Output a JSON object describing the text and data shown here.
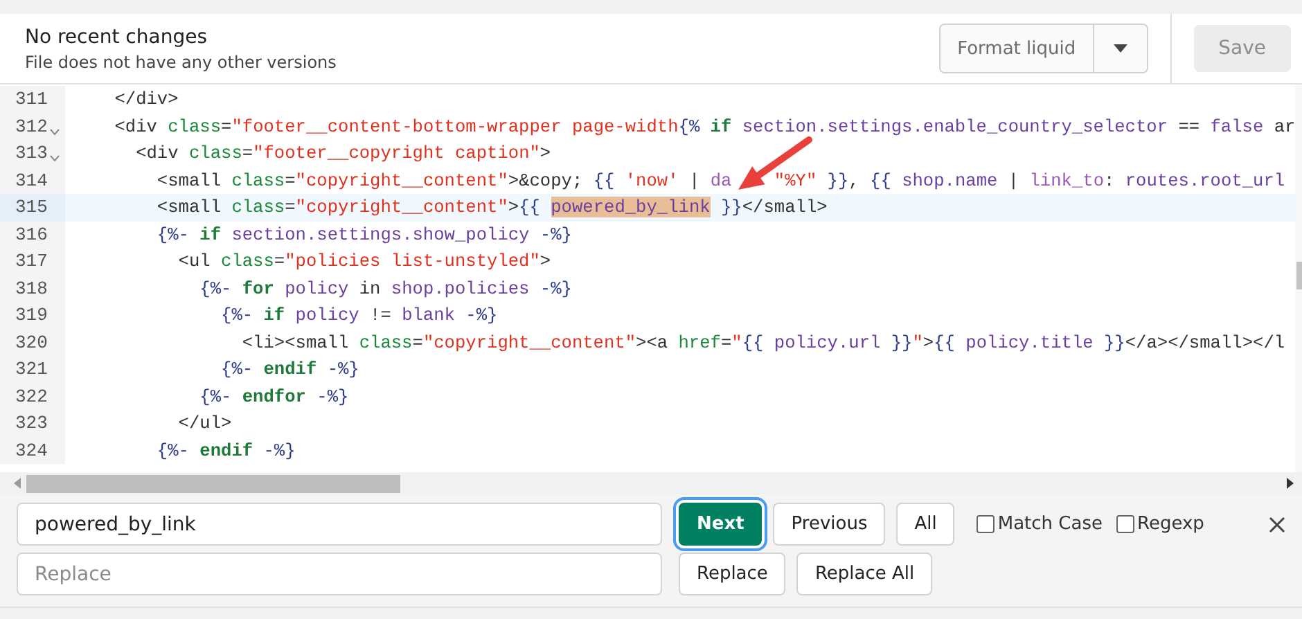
{
  "header": {
    "title": "No recent changes",
    "subtitle": "File does not have any other versions",
    "format_button": "Format liquid",
    "save_button": {
      "label": "Save",
      "disabled": true
    }
  },
  "editor": {
    "lines": [
      {
        "number": "311",
        "fold": false,
        "current": false,
        "tokens": [
          {
            "t": "    </div>",
            "kind": "tag"
          }
        ]
      },
      {
        "number": "312",
        "fold": true,
        "current": false,
        "tokens": [
          {
            "t": "    <div ",
            "kind": "tag"
          },
          {
            "t": "class",
            "kind": "attr"
          },
          {
            "t": "=",
            "kind": "tag"
          },
          {
            "t": "\"footer__content-bottom-wrapper page-width",
            "kind": "str"
          },
          {
            "t": "{%",
            "kind": "liq"
          },
          {
            "t": " if ",
            "kind": "kw"
          },
          {
            "t": "section.settings.enable_country_selector",
            "kind": "var"
          },
          {
            "t": " == ",
            "kind": "tag"
          },
          {
            "t": "false",
            "kind": "var"
          },
          {
            "t": " ar",
            "kind": "tag"
          }
        ]
      },
      {
        "number": "313",
        "fold": true,
        "current": false,
        "tokens": [
          {
            "t": "      <div ",
            "kind": "tag"
          },
          {
            "t": "class",
            "kind": "attr"
          },
          {
            "t": "=",
            "kind": "tag"
          },
          {
            "t": "\"footer__copyright caption\"",
            "kind": "str"
          },
          {
            "t": ">",
            "kind": "tag"
          }
        ]
      },
      {
        "number": "314",
        "fold": false,
        "current": false,
        "tokens": [
          {
            "t": "        <small ",
            "kind": "tag"
          },
          {
            "t": "class",
            "kind": "attr"
          },
          {
            "t": "=",
            "kind": "tag"
          },
          {
            "t": "\"copyright__content\"",
            "kind": "str"
          },
          {
            "t": ">&copy; ",
            "kind": "tag"
          },
          {
            "t": "{{ ",
            "kind": "liq"
          },
          {
            "t": "'now'",
            "kind": "str"
          },
          {
            "t": " | ",
            "kind": "tag"
          },
          {
            "t": "da",
            "kind": "filt"
          },
          {
            "t": "    \"%Y\"",
            "kind": "str"
          },
          {
            "t": " }}",
            "kind": "liq"
          },
          {
            "t": ", ",
            "kind": "tag"
          },
          {
            "t": "{{ ",
            "kind": "liq"
          },
          {
            "t": "shop.name",
            "kind": "var"
          },
          {
            "t": " | ",
            "kind": "tag"
          },
          {
            "t": "link_to",
            "kind": "filt"
          },
          {
            "t": ": ",
            "kind": "tag"
          },
          {
            "t": "routes.root_url",
            "kind": "var"
          }
        ]
      },
      {
        "number": "315",
        "fold": false,
        "current": true,
        "tokens": [
          {
            "t": "        <small ",
            "kind": "tag"
          },
          {
            "t": "class",
            "kind": "attr"
          },
          {
            "t": "=",
            "kind": "tag"
          },
          {
            "t": "\"copyright__content\"",
            "kind": "str"
          },
          {
            "t": ">",
            "kind": "tag"
          },
          {
            "t": "{{ ",
            "kind": "liq"
          },
          {
            "t": "powered_by_link",
            "kind": "match"
          },
          {
            "t": " }}",
            "kind": "liq"
          },
          {
            "t": "</small>",
            "kind": "tag"
          }
        ]
      },
      {
        "number": "316",
        "fold": false,
        "current": false,
        "tokens": [
          {
            "t": "        {%-",
            "kind": "liq"
          },
          {
            "t": " if ",
            "kind": "kw"
          },
          {
            "t": "section.settings.show_policy",
            "kind": "var"
          },
          {
            "t": " -%}",
            "kind": "liq"
          }
        ]
      },
      {
        "number": "317",
        "fold": false,
        "current": false,
        "tokens": [
          {
            "t": "          <ul ",
            "kind": "tag"
          },
          {
            "t": "class",
            "kind": "attr"
          },
          {
            "t": "=",
            "kind": "tag"
          },
          {
            "t": "\"policies list-unstyled\"",
            "kind": "str"
          },
          {
            "t": ">",
            "kind": "tag"
          }
        ]
      },
      {
        "number": "318",
        "fold": false,
        "current": false,
        "tokens": [
          {
            "t": "            {%-",
            "kind": "liq"
          },
          {
            "t": " for ",
            "kind": "kw"
          },
          {
            "t": "policy",
            "kind": "var"
          },
          {
            "t": " in ",
            "kind": "tag"
          },
          {
            "t": "shop.policies",
            "kind": "var"
          },
          {
            "t": " -%}",
            "kind": "liq"
          }
        ]
      },
      {
        "number": "319",
        "fold": false,
        "current": false,
        "tokens": [
          {
            "t": "              {%-",
            "kind": "liq"
          },
          {
            "t": " if ",
            "kind": "kw"
          },
          {
            "t": "policy",
            "kind": "var"
          },
          {
            "t": " != ",
            "kind": "tag"
          },
          {
            "t": "blank",
            "kind": "var"
          },
          {
            "t": " -%}",
            "kind": "liq"
          }
        ]
      },
      {
        "number": "320",
        "fold": false,
        "current": false,
        "tokens": [
          {
            "t": "                <li><small ",
            "kind": "tag"
          },
          {
            "t": "class",
            "kind": "attr"
          },
          {
            "t": "=",
            "kind": "tag"
          },
          {
            "t": "\"copyright__content\"",
            "kind": "str"
          },
          {
            "t": "><a ",
            "kind": "tag"
          },
          {
            "t": "href",
            "kind": "attr"
          },
          {
            "t": "=",
            "kind": "tag"
          },
          {
            "t": "\"",
            "kind": "str"
          },
          {
            "t": "{{ ",
            "kind": "liq"
          },
          {
            "t": "policy.url",
            "kind": "var"
          },
          {
            "t": " }}",
            "kind": "liq"
          },
          {
            "t": "\"",
            "kind": "str"
          },
          {
            "t": ">",
            "kind": "tag"
          },
          {
            "t": "{{ ",
            "kind": "liq"
          },
          {
            "t": "policy.title",
            "kind": "var"
          },
          {
            "t": " }}",
            "kind": "liq"
          },
          {
            "t": "</a></small></l",
            "kind": "tag"
          }
        ]
      },
      {
        "number": "321",
        "fold": false,
        "current": false,
        "tokens": [
          {
            "t": "              {%-",
            "kind": "liq"
          },
          {
            "t": " endif",
            "kind": "kw"
          },
          {
            "t": " -%}",
            "kind": "liq"
          }
        ]
      },
      {
        "number": "322",
        "fold": false,
        "current": false,
        "tokens": [
          {
            "t": "            {%-",
            "kind": "liq"
          },
          {
            "t": " endfor",
            "kind": "kw"
          },
          {
            "t": " -%}",
            "kind": "liq"
          }
        ]
      },
      {
        "number": "323",
        "fold": false,
        "current": false,
        "tokens": [
          {
            "t": "          </ul>",
            "kind": "tag"
          }
        ]
      },
      {
        "number": "324",
        "fold": false,
        "current": false,
        "tokens": [
          {
            "t": "        {%-",
            "kind": "liq"
          },
          {
            "t": " endif",
            "kind": "kw"
          },
          {
            "t": " -%}",
            "kind": "liq"
          }
        ]
      }
    ]
  },
  "find": {
    "search_value": "powered_by_link",
    "replace_placeholder": "Replace",
    "buttons": [
      {
        "label": "Next",
        "primary": true
      },
      {
        "label": "Previous",
        "primary": false
      },
      {
        "label": "All",
        "primary": false
      }
    ],
    "options": [
      {
        "label": "Match Case",
        "checked": false
      },
      {
        "label": "Regexp",
        "checked": false
      }
    ],
    "replace_buttons": [
      "Replace",
      "Replace All"
    ]
  }
}
